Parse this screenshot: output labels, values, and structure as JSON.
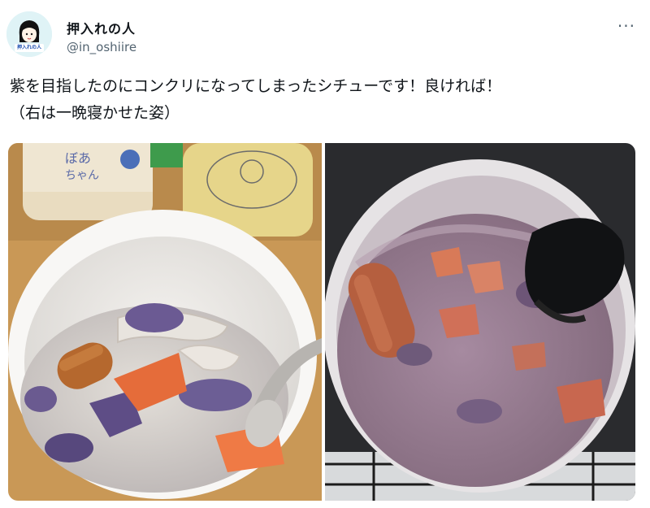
{
  "user": {
    "display_name": "押入れの人",
    "handle": "@in_oshiire",
    "avatar_label": "押入れの人"
  },
  "tweet": {
    "line1": "紫を目指したのにコンクリになってしまったシチューです！良ければ！",
    "line2": "（右は一晩寝かせた姿）"
  },
  "menu": {
    "more_label": "···"
  },
  "media": [
    {
      "name": "photo-left"
    },
    {
      "name": "photo-right"
    }
  ],
  "colors": {
    "stew_left": "#d8d4cf",
    "stew_right": "#9b7f92",
    "carrot": "#e56c3a",
    "purple_potato": "#5e4d86"
  }
}
